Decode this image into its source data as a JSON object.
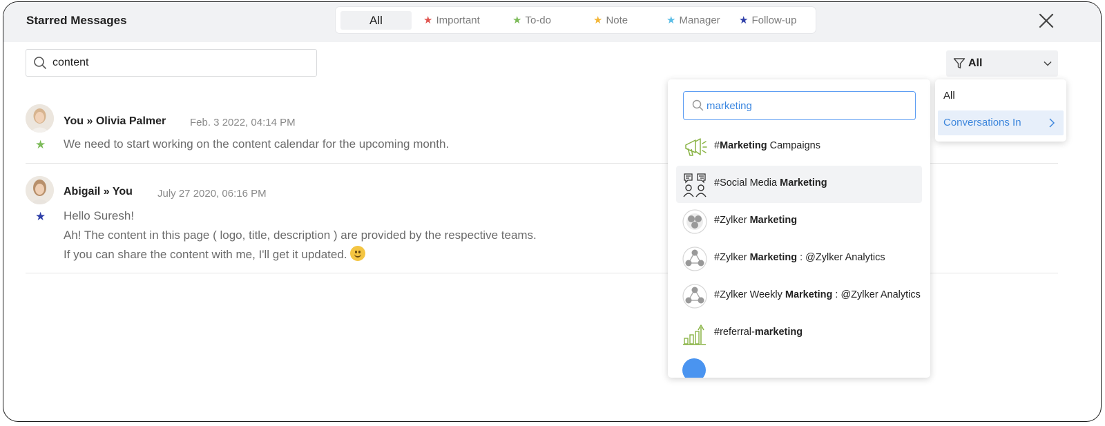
{
  "header": {
    "title": "Starred Messages",
    "tabs": [
      {
        "label": "All",
        "star_color": null
      },
      {
        "label": "Important",
        "star_color": "#e0544f"
      },
      {
        "label": "To-do",
        "star_color": "#7dbb5a"
      },
      {
        "label": "Note",
        "star_color": "#f3b535"
      },
      {
        "label": "Manager",
        "star_color": "#5bbde6"
      },
      {
        "label": "Follow-up",
        "star_color": "#2f3fa8"
      }
    ],
    "close_icon": "close-icon"
  },
  "search": {
    "value": "content",
    "placeholder": ""
  },
  "filter": {
    "label": "All",
    "icon": "filter-icon"
  },
  "messages": [
    {
      "from": "You",
      "to": "Olivia Palmer",
      "separator": "»",
      "time": "Feb. 3 2022, 04:14 PM",
      "star_color": "#7dbb5a",
      "lines": [
        "We need to start working on the content calendar for the upcoming month."
      ]
    },
    {
      "from": "Abigail",
      "to": "You",
      "separator": "»",
      "time": "July 27 2020, 06:16 PM",
      "star_color": "#2f3fa8",
      "lines": [
        "Hello Suresh!",
        "Ah! The content in this page ( logo, title, description ) are provided by the respective teams.",
        "If you can share the content with me, I'll get it updated."
      ],
      "emoji": "slightly-smiling-face"
    }
  ],
  "conversations": {
    "search_value": "marketing",
    "items": [
      {
        "pre": "#",
        "bold": "Marketing",
        "post": " Campaigns",
        "icon": "megaphone-icon"
      },
      {
        "pre": "#Social Media ",
        "bold": "Marketing",
        "post": "",
        "icon": "people-talking-icon"
      },
      {
        "pre": "#Zylker ",
        "bold": "Marketing",
        "post": "",
        "icon": "group-icon"
      },
      {
        "pre": "#Zylker ",
        "bold": "Marketing",
        "post": " : @Zylker Analytics",
        "icon": "network-icon"
      },
      {
        "pre": "#Zylker Weekly ",
        "bold": "Marketing",
        "post": " : @Zylker Analytics",
        "icon": "network-icon"
      },
      {
        "pre": "#referral-",
        "bold": "marketing",
        "post": "",
        "icon": "growth-chart-icon"
      }
    ]
  },
  "filter_menu": {
    "items": [
      "All",
      "Conversations In"
    ]
  }
}
